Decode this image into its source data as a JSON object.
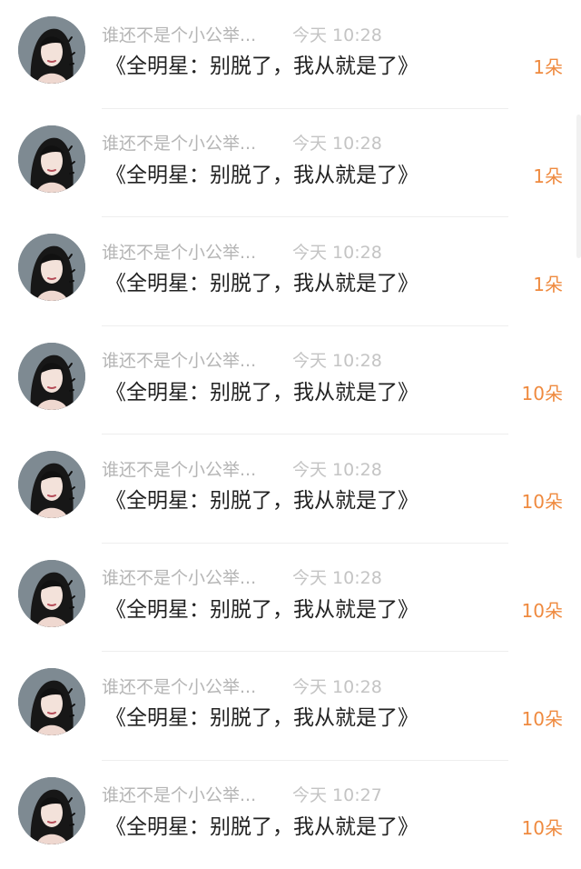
{
  "comments": [
    {
      "username": "谁还不是个小公举...",
      "time": "今天 10:28",
      "message": "《全明星：别脱了，我从就是了》",
      "flowers": "1朵"
    },
    {
      "username": "谁还不是个小公举...",
      "time": "今天 10:28",
      "message": "《全明星：别脱了，我从就是了》",
      "flowers": "1朵"
    },
    {
      "username": "谁还不是个小公举...",
      "time": "今天 10:28",
      "message": "《全明星：别脱了，我从就是了》",
      "flowers": "1朵"
    },
    {
      "username": "谁还不是个小公举...",
      "time": "今天 10:28",
      "message": "《全明星：别脱了，我从就是了》",
      "flowers": "10朵"
    },
    {
      "username": "谁还不是个小公举...",
      "time": "今天 10:28",
      "message": "《全明星：别脱了，我从就是了》",
      "flowers": "10朵"
    },
    {
      "username": "谁还不是个小公举...",
      "time": "今天 10:28",
      "message": "《全明星：别脱了，我从就是了》",
      "flowers": "10朵"
    },
    {
      "username": "谁还不是个小公举...",
      "time": "今天 10:28",
      "message": "《全明星：别脱了，我从就是了》",
      "flowers": "10朵"
    },
    {
      "username": "谁还不是个小公举...",
      "time": "今天 10:27",
      "message": "《全明星：别脱了，我从就是了》",
      "flowers": "10朵"
    }
  ],
  "avatar_icon": "avatar-portrait-icon",
  "colors": {
    "meta_text": "#b5b5b5",
    "message_text": "#222222",
    "flower_count": "#ef8a3f",
    "divider": "#eeeeee"
  }
}
